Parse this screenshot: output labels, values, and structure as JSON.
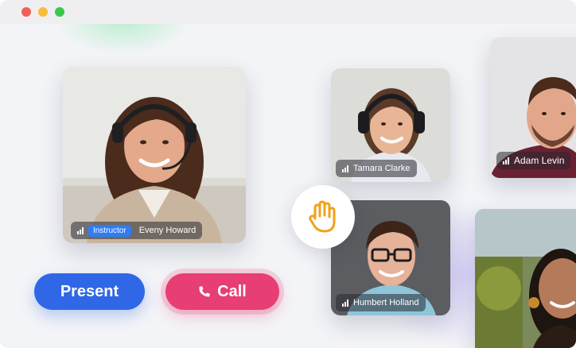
{
  "window": {
    "controls": [
      "close",
      "minimize",
      "maximize"
    ]
  },
  "participants": [
    {
      "name": "Eveny Howard",
      "role_badge": "Instructor"
    },
    {
      "name": "Tamara Clarke"
    },
    {
      "name": "Adam Levin"
    },
    {
      "name": "Humbert Holland"
    },
    {
      "name": ""
    }
  ],
  "actions": {
    "present_label": "Present",
    "call_label": "Call",
    "raise_hand_icon": "hand-wave-icon"
  },
  "colors": {
    "present": "#2f67e6",
    "call": "#e73e73",
    "instructor_badge": "#2f7cf6",
    "hand_icon": "#f0a21b"
  }
}
